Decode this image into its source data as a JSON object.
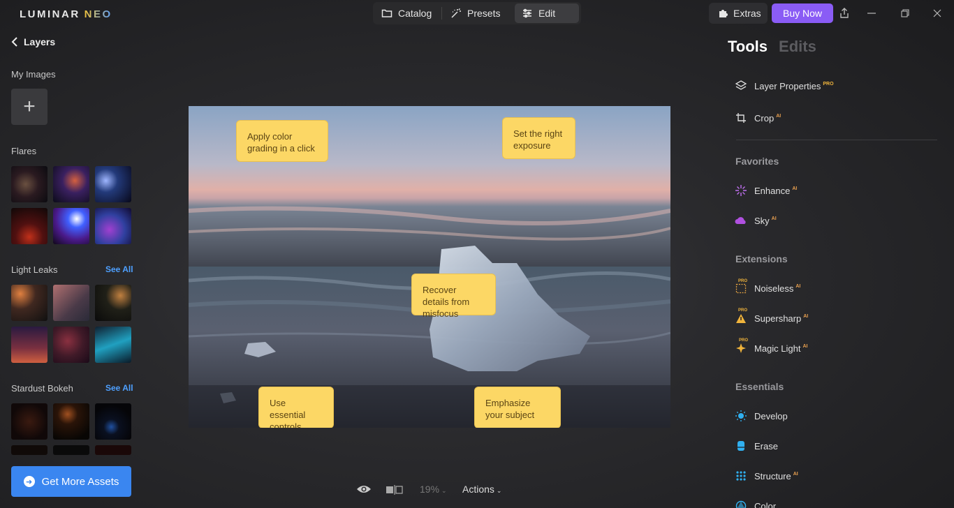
{
  "app": {
    "logo_main": "LUMINAR",
    "logo_sub": "NEO"
  },
  "nav": {
    "catalog": "Catalog",
    "presets": "Presets",
    "edit": "Edit",
    "active": "Edit"
  },
  "header": {
    "extras": "Extras",
    "buy_now": "Buy Now",
    "accent_color": "#8a5cf5"
  },
  "left_panel": {
    "back_label": "Layers",
    "my_images": "My Images",
    "flares": "Flares",
    "light_leaks": "Light Leaks",
    "stardust_bokeh": "Stardust Bokeh",
    "see_all": "See All",
    "get_more_assets": "Get More Assets"
  },
  "canvas": {
    "callouts": {
      "color_grading": "Apply color grading in a click",
      "exposure": "Set the right exposure",
      "misfocus": "Recover details from misfocus",
      "essential": "Use essential controls",
      "subject": "Emphasize your subject"
    }
  },
  "bottom_bar": {
    "zoom": "19%",
    "actions": "Actions"
  },
  "right_panel": {
    "tab_tools": "Tools",
    "tab_edits": "Edits",
    "active_tab": "Tools",
    "tools_top": [
      {
        "label": "Layer Properties",
        "badge": "PRO",
        "icon": "layers-icon"
      },
      {
        "label": "Crop",
        "badge": "AI",
        "icon": "crop-icon"
      }
    ],
    "favorites_title": "Favorites",
    "favorites": [
      {
        "label": "Enhance",
        "badge": "AI",
        "icon": "enhance-icon"
      },
      {
        "label": "Sky",
        "badge": "AI",
        "icon": "cloud-icon"
      }
    ],
    "extensions_title": "Extensions",
    "extensions": [
      {
        "label": "Noiseless",
        "badge": "AI",
        "icon": "noiseless-icon"
      },
      {
        "label": "Supersharp",
        "badge": "AI",
        "icon": "supersharp-icon"
      },
      {
        "label": "Magic Light",
        "badge": "AI",
        "icon": "magic-light-icon"
      }
    ],
    "essentials_title": "Essentials",
    "essentials": [
      {
        "label": "Develop",
        "badge": "",
        "icon": "sun-icon"
      },
      {
        "label": "Erase",
        "badge": "",
        "icon": "eraser-icon"
      },
      {
        "label": "Structure",
        "badge": "AI",
        "icon": "structure-icon"
      },
      {
        "label": "Color",
        "badge": "",
        "icon": "color-icon"
      }
    ],
    "pro_badge": "PRO"
  }
}
